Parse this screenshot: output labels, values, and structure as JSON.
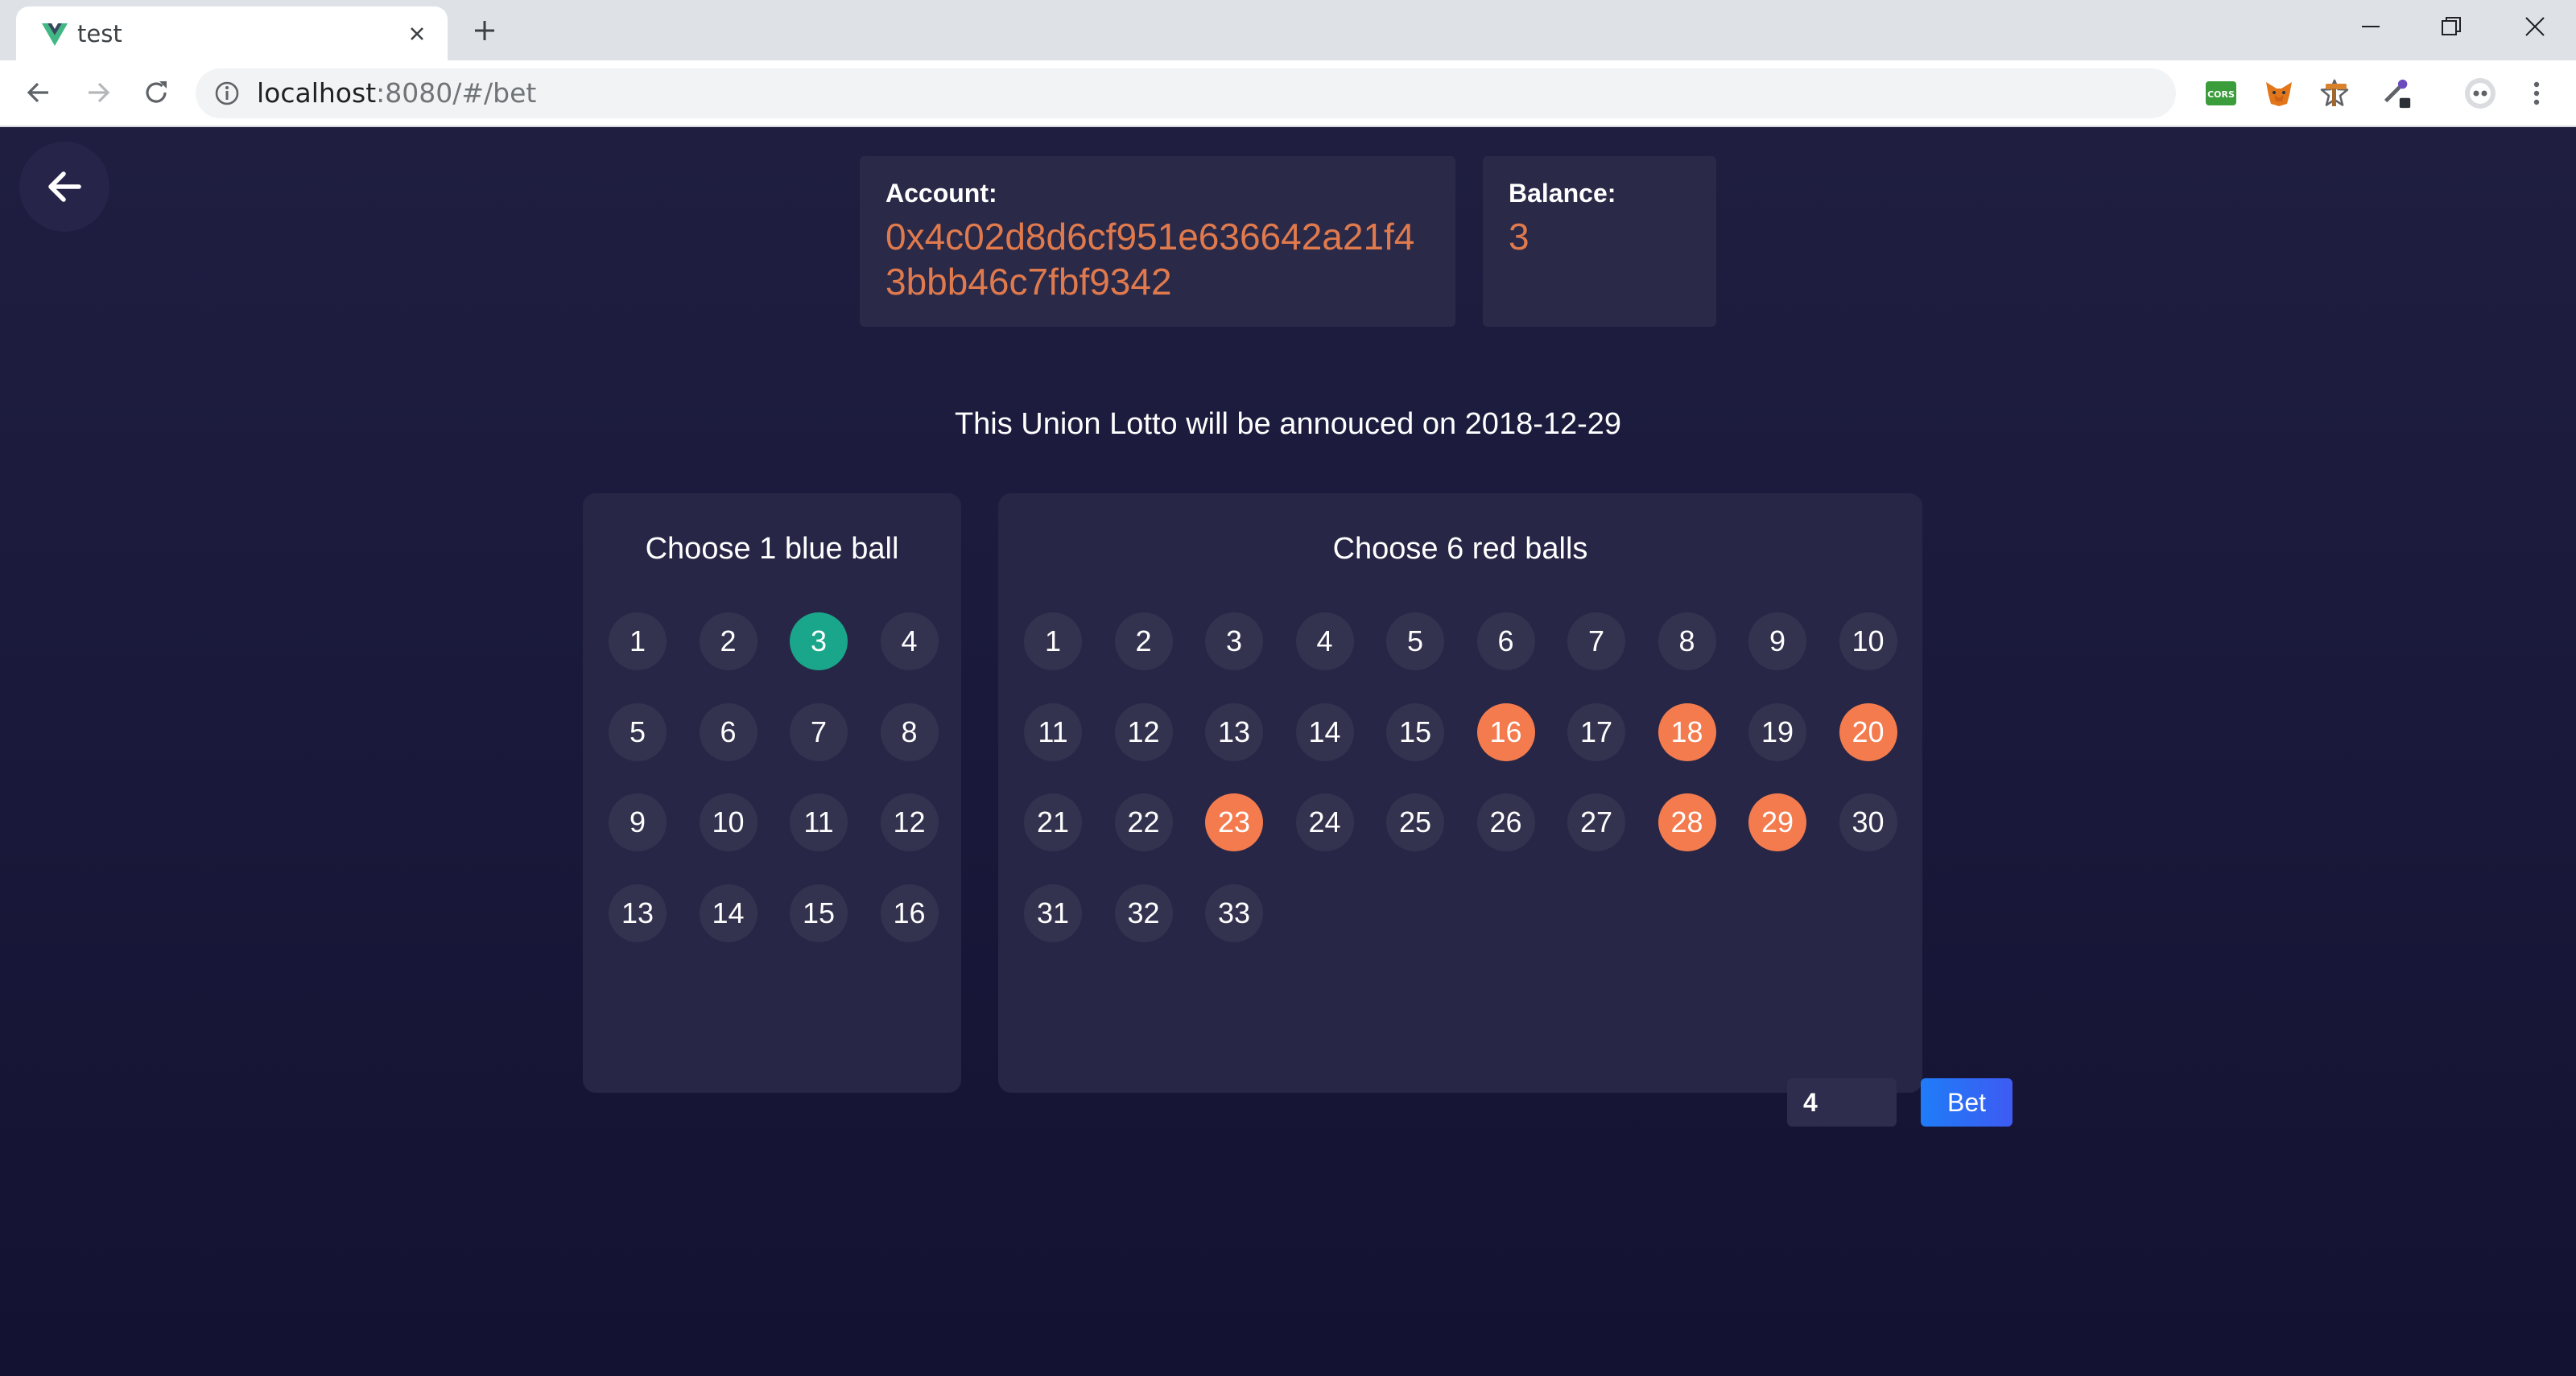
{
  "browser": {
    "tab_title": "test",
    "url_host": "localhost",
    "url_rest": ":8080/#/bet",
    "extensions": [
      "cors-extension-icon",
      "metamask-fox-icon",
      "pickaxe-extension-icon",
      "eyedropper-extension-icon"
    ]
  },
  "account": {
    "label": "Account:",
    "value": "0x4c02d8d6cf951e636642a21f43bbb46c7fbf9342"
  },
  "balance": {
    "label": "Balance:",
    "value": "3"
  },
  "announcement": "This Union Lotto will be annouced on 2018-12-29",
  "blue_panel": {
    "title": "Choose 1 blue ball",
    "balls": [
      "1",
      "2",
      "3",
      "4",
      "5",
      "6",
      "7",
      "8",
      "9",
      "10",
      "11",
      "12",
      "13",
      "14",
      "15",
      "16"
    ],
    "selected": [
      "3"
    ]
  },
  "red_panel": {
    "title": "Choose 6 red balls",
    "balls": [
      "1",
      "2",
      "3",
      "4",
      "5",
      "6",
      "7",
      "8",
      "9",
      "10",
      "11",
      "12",
      "13",
      "14",
      "15",
      "16",
      "17",
      "18",
      "19",
      "20",
      "21",
      "22",
      "23",
      "24",
      "25",
      "26",
      "27",
      "28",
      "29",
      "30",
      "31",
      "32",
      "33"
    ],
    "selected": [
      "16",
      "18",
      "20",
      "23",
      "28",
      "29"
    ]
  },
  "bet": {
    "amount": "4",
    "button_label": "Bet"
  },
  "colors": {
    "selected_blue": "#1aa68a",
    "selected_red": "#f47b4e",
    "value_orange": "#e07a4d",
    "bet_button": "#2f6cf5"
  }
}
